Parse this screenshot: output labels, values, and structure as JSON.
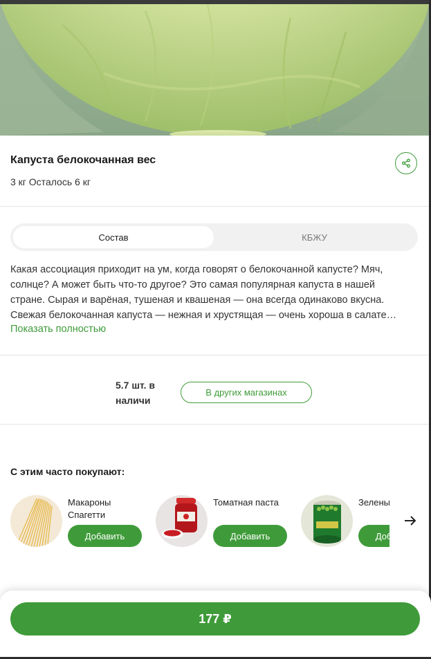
{
  "product": {
    "title": "Капуста белокочанная вес",
    "stock": "3 кг Осталось 6 кг"
  },
  "tabs": [
    {
      "label": "Состав",
      "active": true
    },
    {
      "label": "КБЖУ",
      "active": false
    }
  ],
  "description": {
    "text": "Какая ассоциация приходит на ум, когда говорят о белокочанной капусте? Мяч, солнце? А может быть что-то другое? Это самая популярная капуста в нашей стране. Сырая и варёная, тушеная и квашеная — она всегда одинаково вкусна. Свежая белокочанная капуста — нежная и хрустящая — очень хороша в салате…",
    "show_more": "Показать полностью"
  },
  "availability": {
    "text": "5.7 шт. в наличи",
    "other_stores": "В других магазинах"
  },
  "often_bought": {
    "title": "С этим часто покупают:",
    "items": [
      {
        "name": "Макароны Спагетти",
        "add": "Добавить",
        "icon": "spaghetti-image"
      },
      {
        "name": "Томатная паста",
        "add": "Добавить",
        "icon": "tomato-paste-image"
      },
      {
        "name": "Зеленый горошек",
        "add": "Добавить",
        "icon": "green-peas-can-image"
      }
    ]
  },
  "buy": {
    "price_label": "177 ₽"
  },
  "colors": {
    "accent": "#3f9b3a",
    "tab_bg": "#f1f1f1"
  }
}
